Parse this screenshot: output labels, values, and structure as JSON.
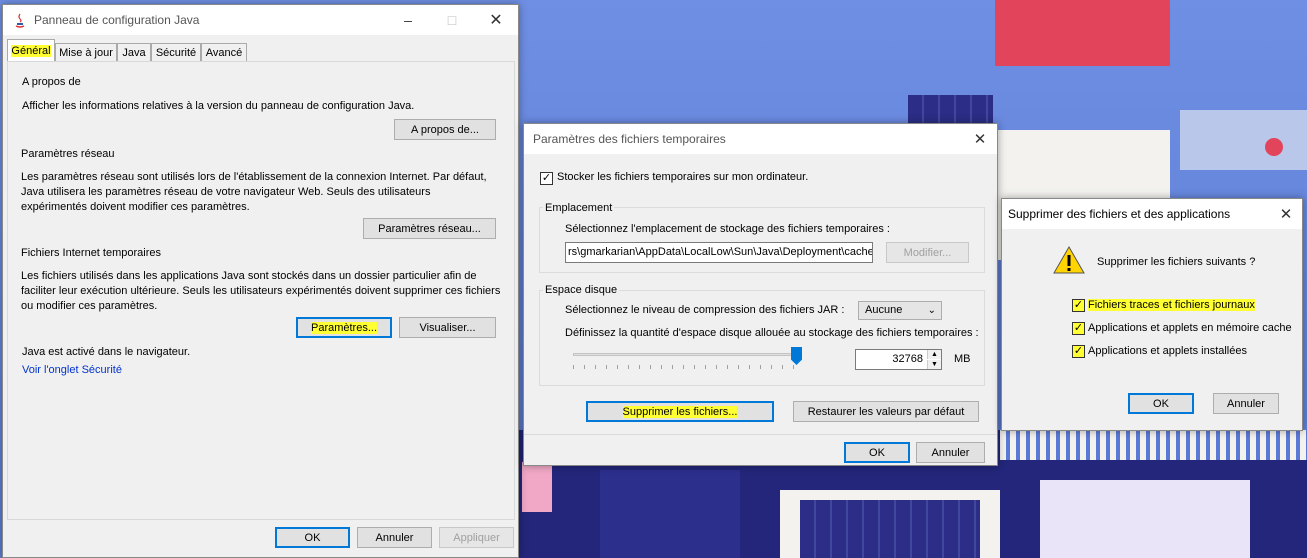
{
  "java_panel": {
    "title": "Panneau de configuration Java",
    "tabs": [
      "Général",
      "Mise à jour",
      "Java",
      "Sécurité",
      "Avancé"
    ],
    "about": {
      "heading": "A propos de",
      "description": "Afficher les informations relatives à la version du panneau de configuration Java.",
      "button": "A propos de..."
    },
    "network": {
      "heading": "Paramètres réseau",
      "description": "Les paramètres réseau sont utilisés lors de l'établissement de la connexion Internet. Par défaut, Java utilisera les paramètres réseau de votre navigateur Web. Seuls des utilisateurs expérimentés doivent modifier ces paramètres.",
      "button": "Paramètres réseau..."
    },
    "temp_files": {
      "heading": "Fichiers Internet temporaires",
      "description": "Les fichiers utilisés dans les applications Java sont stockés dans un dossier particulier afin de faciliter leur exécution ultérieure. Seuls les utilisateurs expérimentés doivent supprimer ces fichiers ou modifier ces paramètres.",
      "settings_button": "Paramètres...",
      "view_button": "Visualiser..."
    },
    "browser_status": "Java est activé dans le navigateur.",
    "security_link": "Voir l'onglet Sécurité",
    "footer": {
      "ok": "OK",
      "cancel": "Annuler",
      "apply": "Appliquer"
    }
  },
  "temp_dialog": {
    "title": "Paramètres des fichiers temporaires",
    "keep_files_label": "Stocker les fichiers temporaires sur mon ordinateur.",
    "keep_files_checked": true,
    "location": {
      "group_label": "Emplacement",
      "instruction": "Sélectionnez l'emplacement de stockage des fichiers temporaires :",
      "path": "rs\\gmarkarian\\AppData\\LocalLow\\Sun\\Java\\Deployment\\cache",
      "modify_button": "Modifier..."
    },
    "disk": {
      "group_label": "Espace disque",
      "compression_label": "Sélectionnez le niveau de compression des fichiers JAR :",
      "compression_value": "Aucune",
      "space_label": "Définissez la quantité d'espace disque allouée au stockage des fichiers temporaires :",
      "space_value": "32768",
      "unit": "MB"
    },
    "delete_button": "Supprimer les fichiers...",
    "restore_button": "Restaurer les valeurs par défaut",
    "ok": "OK",
    "cancel": "Annuler"
  },
  "delete_dialog": {
    "title": "Supprimer des fichiers et des applications",
    "question": "Supprimer les fichiers suivants ?",
    "options": [
      {
        "label": "Fichiers traces et fichiers journaux",
        "checked": true
      },
      {
        "label": "Applications et applets en mémoire cache",
        "checked": true
      },
      {
        "label": "Applications et applets installées",
        "checked": true
      }
    ],
    "ok": "OK",
    "cancel": "Annuler"
  },
  "colors": {
    "highlight": "#ffff33",
    "link": "#0033cc",
    "accent": "#0078d7"
  }
}
